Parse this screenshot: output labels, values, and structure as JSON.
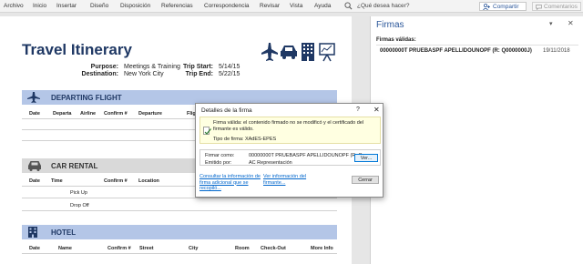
{
  "ribbon": {
    "tabs": [
      "Archivo",
      "Inicio",
      "Insertar",
      "Diseño",
      "Disposición",
      "Referencias",
      "Correspondencia",
      "Revisar",
      "Vista",
      "Ayuda"
    ],
    "search_text": "¿Qué desea hacer?",
    "share_label": "Compartir",
    "comments_label": "Comentarios"
  },
  "document": {
    "title": "Travel Itinerary",
    "purpose_label": "Purpose:",
    "purpose": "Meetings & Training",
    "destination_label": "Destination:",
    "destination": "New York City",
    "trip_start_label": "Trip Start:",
    "trip_start": "5/14/15",
    "trip_end_label": "Trip End:",
    "trip_end": "5/22/15",
    "departing": {
      "title": "DEPARTING FLIGHT",
      "columns": [
        "Date",
        "Departa",
        "Airline",
        "Confirm #",
        "Departure",
        "Flig"
      ]
    },
    "car": {
      "title": "CAR RENTAL",
      "columns": [
        "Date",
        "Time",
        "Confirm #",
        "Location"
      ],
      "rows": [
        "Pick Up",
        "Drop Off"
      ]
    },
    "hotel": {
      "title": "HOTEL",
      "columns": [
        "Date",
        "Name",
        "Confirm #",
        "Street",
        "City",
        "Room",
        "Check-Out",
        "More Info"
      ]
    }
  },
  "dialog": {
    "title": "Detalles de la firma",
    "help": "?",
    "close_x": "✕",
    "status_text": "Firma válida: el contenido firmado no se modificó y el certificado del firmante es válido.",
    "sig_type": "Tipo de firma: XAdES-EPES",
    "signer_label": "Firmar como:",
    "signer_value": "00000000T PRUEBASPF APELLIDOUNOPF (R: Q...",
    "issuer_label": "Emitido por:",
    "issuer_value": "AC Representación",
    "view_button": "Ver...",
    "link_info": "Consultar la información de firma adicional que se recopiló...",
    "link_signer": "Ver información del firmante...",
    "close_button": "Cerrar"
  },
  "pane": {
    "title": "Firmas",
    "valid_label": "Firmas válidas:",
    "entry_name": "00000000T PRUEBASPF APELLIDOUNOPF (R: Q0000000J)",
    "entry_date": "19/11/2018"
  },
  "colors": {
    "accent": "#2b579a",
    "doc_title": "#1f3864",
    "section_blue": "#b4c6e7",
    "section_gray": "#d9d9d9",
    "status_bg": "#ffffe1"
  }
}
